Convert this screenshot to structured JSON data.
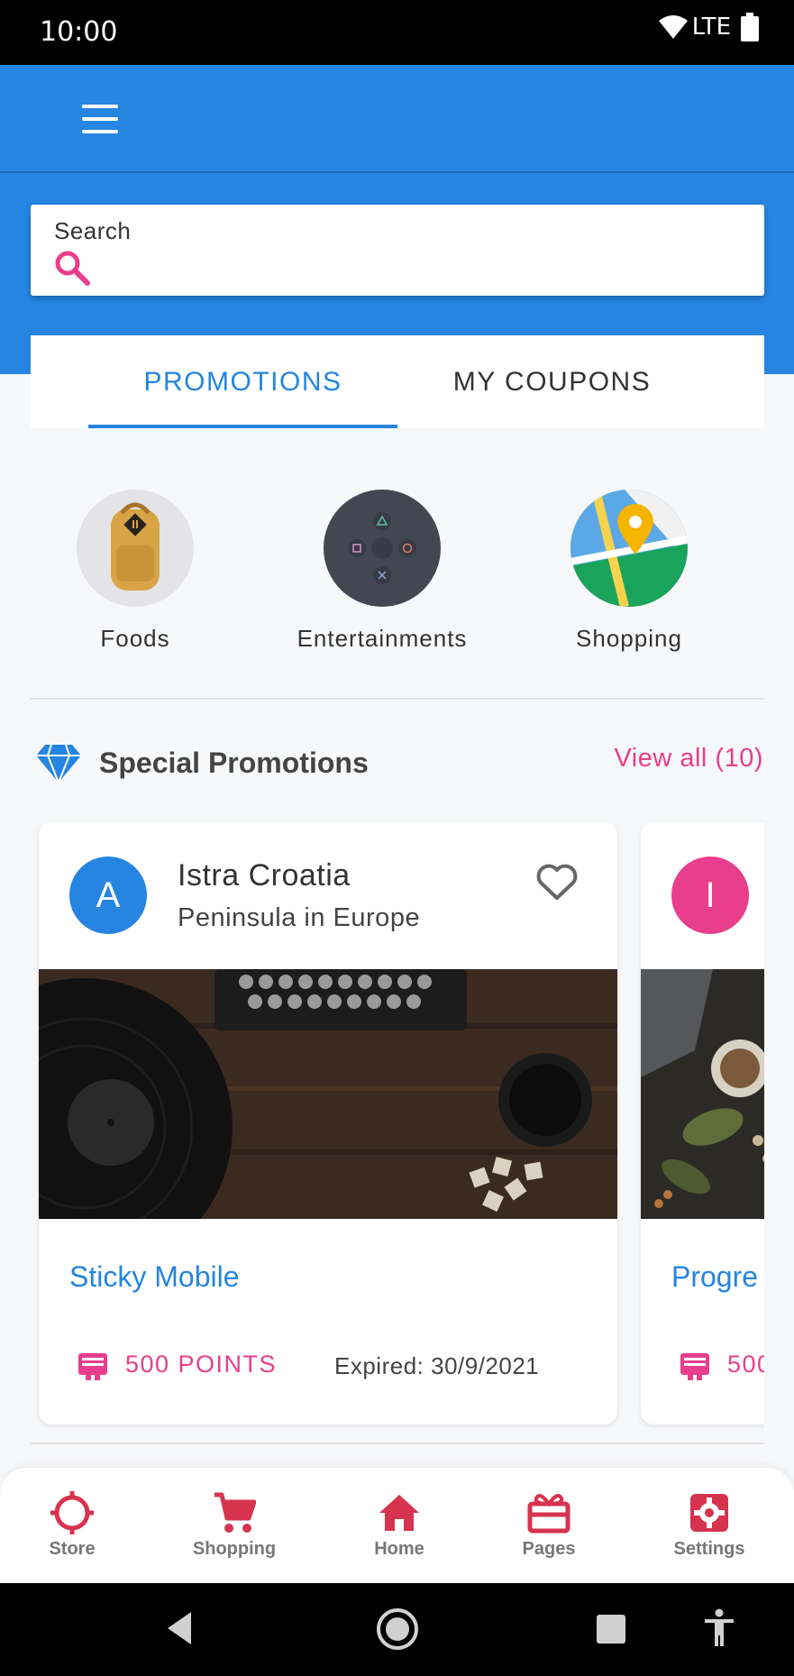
{
  "status_bar": {
    "time": "10:00",
    "network": "LTE"
  },
  "search": {
    "label": "Search"
  },
  "tabs": [
    {
      "label": "PROMOTIONS",
      "active": true
    },
    {
      "label": "MY COUPONS",
      "active": false
    }
  ],
  "categories": [
    {
      "label": "Foods",
      "icon": "backpack-icon"
    },
    {
      "label": "Entertainments",
      "icon": "gamepad-icon"
    },
    {
      "label": "Shopping",
      "icon": "map-pin-icon"
    }
  ],
  "section": {
    "title": "Special Promotions",
    "view_all": "View all (10)"
  },
  "cards": [
    {
      "avatar_letter": "A",
      "avatar_color": "#2585e0",
      "title": "Istra Croatia",
      "subtitle": "Peninsula in Europe",
      "name": "Sticky Mobile",
      "points": "500 POINTS",
      "expired": "Expired: 30/9/2021"
    },
    {
      "avatar_letter": "I",
      "avatar_color": "#e83e8c",
      "name": "Progre",
      "points": "500"
    }
  ],
  "bottom_nav": [
    {
      "label": "Store",
      "icon": "target-icon"
    },
    {
      "label": "Shopping",
      "icon": "cart-icon"
    },
    {
      "label": "Home",
      "icon": "home-icon"
    },
    {
      "label": "Pages",
      "icon": "gift-icon"
    },
    {
      "label": "Settings",
      "icon": "gear-icon"
    }
  ],
  "colors": {
    "primary": "#2585e0",
    "accent": "#e83e8c",
    "nav_red": "#d6334f"
  }
}
